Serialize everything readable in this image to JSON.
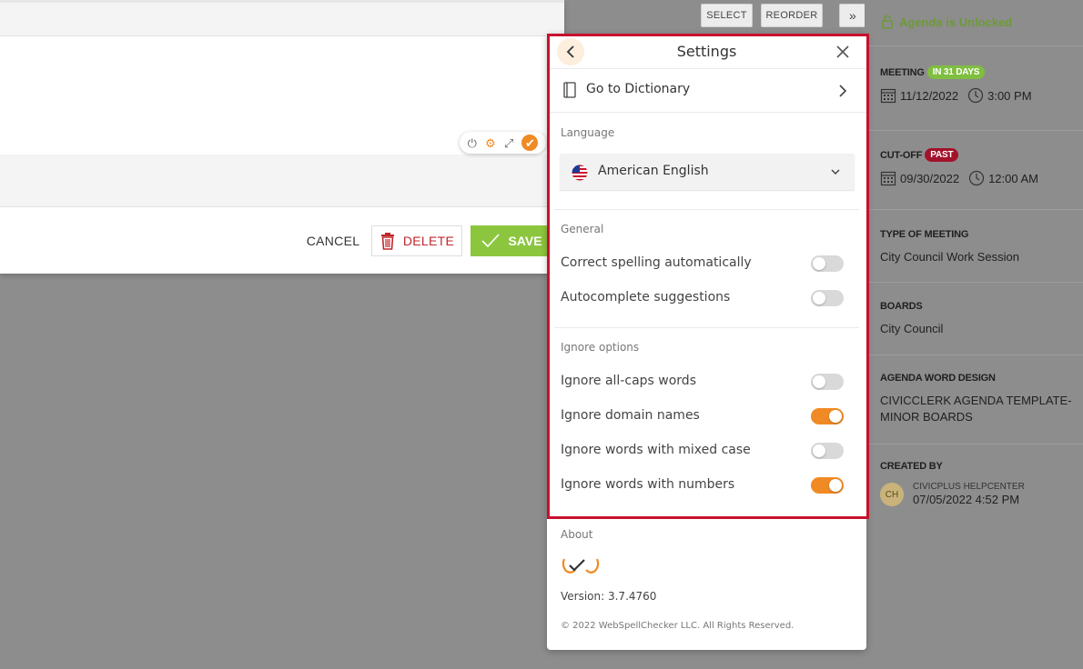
{
  "toolbar": {
    "select_label": "SELECT",
    "reorder_label": "REORDER",
    "collapse_label": "»"
  },
  "dialog": {
    "cancel_label": "CANCEL",
    "delete_label": "DELETE",
    "save_label": "SAVE"
  },
  "info": {
    "status": "Agenda is Unlocked",
    "meeting_label": "MEETING",
    "meeting_badge": "IN 31 DAYS",
    "meeting_date": "11/12/2022",
    "meeting_time": "3:00 PM",
    "cutoff_label": "CUT-OFF",
    "cutoff_badge": "PAST",
    "cutoff_date": "09/30/2022",
    "cutoff_time": "12:00 AM",
    "type_label": "TYPE OF MEETING",
    "type_value": "City Council Work Session",
    "boards_label": "BOARDS",
    "boards_value": "City Council",
    "design_label": "AGENDA WORD DESIGN",
    "design_value_1": "CIVICCLERK AGENDA TEMPLATE-",
    "design_value_2": "MINOR BOARDS",
    "created_label": "CREATED BY",
    "creator_initials": "CH",
    "creator_name": "CIVICPLUS HELPCENTER",
    "creator_date": "07/05/2022 4:52 PM"
  },
  "settings": {
    "title": "Settings",
    "dictionary_label": "Go to Dictionary",
    "language_section": "Language",
    "language_value": "American English",
    "general_section": "General",
    "general": [
      {
        "label": "Correct spelling automatically",
        "on": false
      },
      {
        "label": "Autocomplete suggestions",
        "on": false
      }
    ],
    "ignore_section": "Ignore options",
    "ignore": [
      {
        "label": "Ignore all-caps words",
        "on": false
      },
      {
        "label": "Ignore domain names",
        "on": true
      },
      {
        "label": "Ignore words with mixed case",
        "on": false
      },
      {
        "label": "Ignore words with numbers",
        "on": true
      }
    ],
    "about_section": "About",
    "version": "Version: 3.7.4760",
    "copyright": "© 2022 WebSpellChecker LLC. All Rights Reserved."
  },
  "colors": {
    "accent": "#f08a24",
    "highlight": "#c8102e",
    "save": "#8cc63f",
    "delete": "#c0272d"
  }
}
